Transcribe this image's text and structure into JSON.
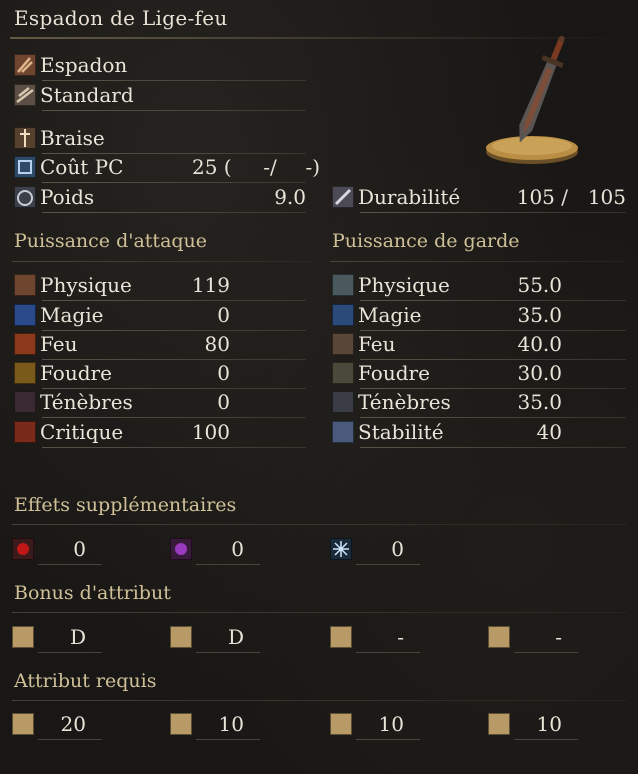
{
  "title": "Espadon de Lige-feu",
  "weapon_type": "Espadon",
  "attack_type": "Standard",
  "skill": "Braise",
  "fp_cost": {
    "label": "Coût PC",
    "value": "25 (",
    "mid": "-/",
    "end": "-)"
  },
  "weight": {
    "label": "Poids",
    "value": "9.0"
  },
  "durability": {
    "label": "Durabilité",
    "current": "105 /",
    "max": "105"
  },
  "attack": {
    "header": "Puissance d'attaque",
    "rows": [
      {
        "label": "Physique",
        "value": "119"
      },
      {
        "label": "Magie",
        "value": "0"
      },
      {
        "label": "Feu",
        "value": "80"
      },
      {
        "label": "Foudre",
        "value": "0"
      },
      {
        "label": "Ténèbres",
        "value": "0"
      },
      {
        "label": "Critique",
        "value": "100"
      }
    ]
  },
  "guard": {
    "header": "Puissance de garde",
    "rows": [
      {
        "label": "Physique",
        "value": "55.0"
      },
      {
        "label": "Magie",
        "value": "35.0"
      },
      {
        "label": "Feu",
        "value": "40.0"
      },
      {
        "label": "Foudre",
        "value": "30.0"
      },
      {
        "label": "Ténèbres",
        "value": "35.0"
      },
      {
        "label": "Stabilité",
        "value": "40"
      }
    ]
  },
  "effects": {
    "header": "Effets supplémentaires",
    "items": [
      {
        "icon": "bleed-icon",
        "value": "0"
      },
      {
        "icon": "poison-icon",
        "value": "0"
      },
      {
        "icon": "frost-icon",
        "value": "0"
      }
    ]
  },
  "scaling": {
    "header": "Bonus d'attribut",
    "items": [
      {
        "icon": "strength-icon",
        "value": "D"
      },
      {
        "icon": "dexterity-icon",
        "value": "D"
      },
      {
        "icon": "intelligence-icon",
        "value": "-"
      },
      {
        "icon": "faith-icon",
        "value": "-"
      }
    ]
  },
  "requirements": {
    "header": "Attribut requis",
    "items": [
      {
        "icon": "strength-icon",
        "value": "20"
      },
      {
        "icon": "dexterity-icon",
        "value": "10"
      },
      {
        "icon": "intelligence-icon",
        "value": "10"
      },
      {
        "icon": "faith-icon",
        "value": "10"
      }
    ]
  },
  "colors": {
    "background": "#191715",
    "section_header": "#cfc097",
    "text": "#e9e4d8"
  }
}
